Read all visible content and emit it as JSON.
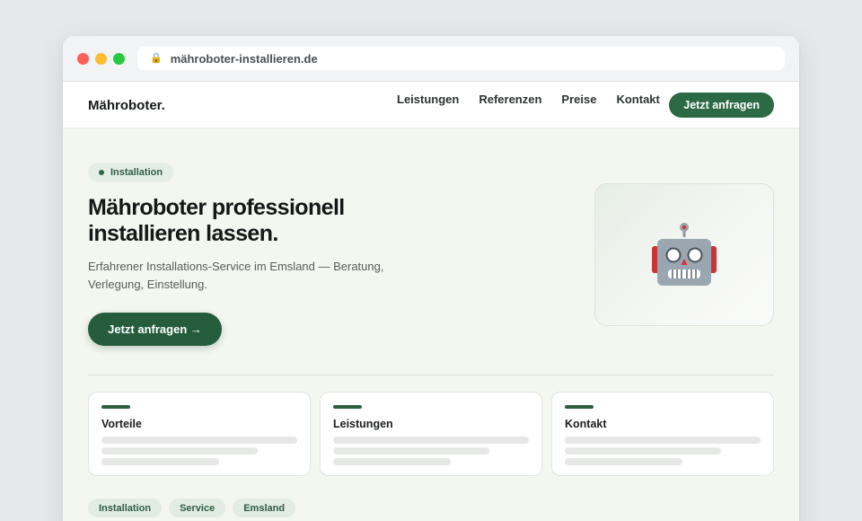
{
  "browser": {
    "url": "mähroboter-installieren.de",
    "lock_icon": "lock-icon"
  },
  "nav": {
    "logo": "Mähroboter.",
    "links": [
      "Leistungen",
      "Referenzen",
      "Preise",
      "Kontakt"
    ],
    "cta": "Jetzt anfragen"
  },
  "hero": {
    "badge": "Installation",
    "title": "Mähroboter professionell installieren lassen.",
    "subtitle": "Erfahrener Installations-Service im Emsland — Beratung, Verlegung, Einstellung.",
    "cta": "Jetzt anfragen →",
    "illustration_icon": "robot-icon"
  },
  "cards": [
    {
      "title": "Vorteile"
    },
    {
      "title": "Leistungen"
    },
    {
      "title": "Kontakt"
    }
  ],
  "tags": [
    "Installation",
    "Service",
    "Emsland"
  ],
  "colors": {
    "brand": "#2b6a45",
    "brand_dark": "#245c3c",
    "page_bg": "#f4f6f0"
  }
}
